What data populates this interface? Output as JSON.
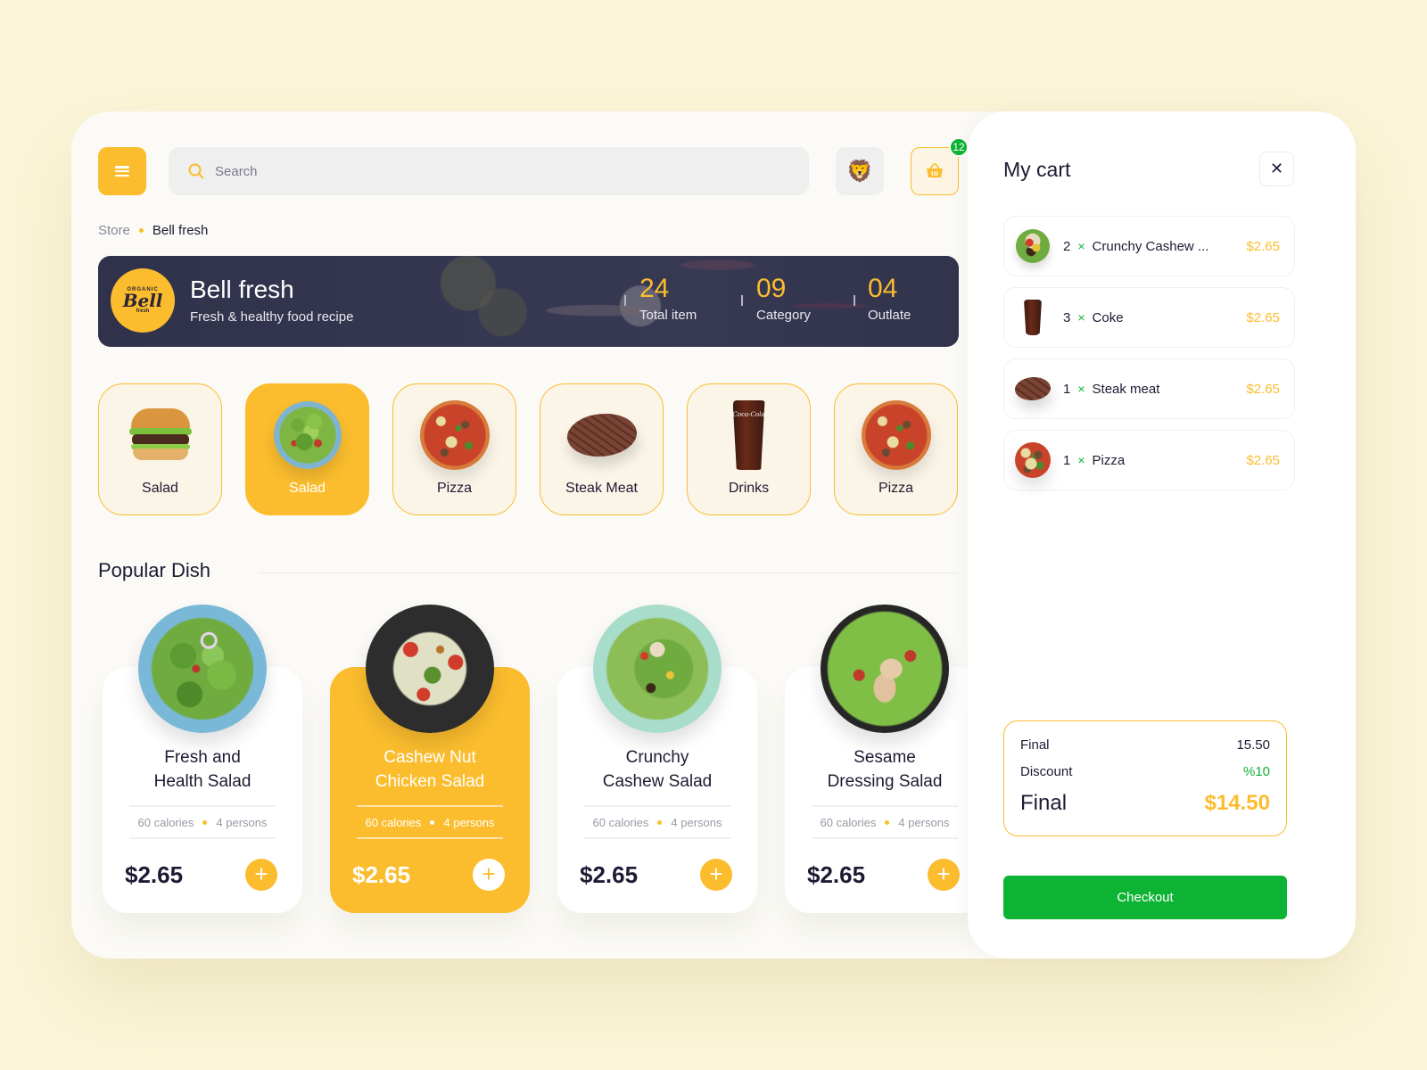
{
  "header": {
    "search_placeholder": "Search",
    "avatar_emoji": "🦁",
    "cart_badge_count": "12"
  },
  "breadcrumb": {
    "root": "Store",
    "current": "Bell fresh"
  },
  "store": {
    "logo_top": "ORGANIC",
    "logo_main": "Bell",
    "logo_bottom": "fresh",
    "name": "Bell fresh",
    "tagline": "Fresh & healthy food recipe",
    "stats": [
      {
        "value": "24",
        "label": "Total item"
      },
      {
        "value": "09",
        "label": "Category"
      },
      {
        "value": "04",
        "label": "Outlate"
      }
    ]
  },
  "categories": [
    {
      "label": "Salad",
      "icon": "burger",
      "active": false
    },
    {
      "label": "Salad",
      "icon": "salad",
      "active": true
    },
    {
      "label": "Pizza",
      "icon": "pizza",
      "active": false
    },
    {
      "label": "Steak Meat",
      "icon": "steak",
      "active": false
    },
    {
      "label": "Drinks",
      "icon": "cola",
      "active": false
    },
    {
      "label": "Pizza",
      "icon": "pizza",
      "active": false
    }
  ],
  "popular": {
    "title": "Popular Dish",
    "dishes": [
      {
        "name_line1": "Fresh and",
        "name_line2": "Health Salad",
        "calories": "60 calories",
        "persons": "4 persons",
        "price": "$2.65",
        "active": false
      },
      {
        "name_line1": "Cashew Nut",
        "name_line2": "Chicken Salad",
        "calories": "60 calories",
        "persons": "4 persons",
        "price": "$2.65",
        "active": true
      },
      {
        "name_line1": "Crunchy",
        "name_line2": "Cashew Salad",
        "calories": "60 calories",
        "persons": "4 persons",
        "price": "$2.65",
        "active": false
      },
      {
        "name_line1": "Sesame",
        "name_line2": "Dressing Salad",
        "calories": "60 calories",
        "persons": "4 persons",
        "price": "$2.65",
        "active": false
      }
    ],
    "add_symbol": "+"
  },
  "cart": {
    "title": "My cart",
    "close_symbol": "✕",
    "items": [
      {
        "qty": "2",
        "times": "×",
        "name": "Crunchy Cashew ...",
        "price": "$2.65",
        "icon": "salad"
      },
      {
        "qty": "3",
        "times": "×",
        "name": "Coke",
        "price": "$2.65",
        "icon": "cola"
      },
      {
        "qty": "1",
        "times": "×",
        "name": "Steak meat",
        "price": "$2.65",
        "icon": "steak"
      },
      {
        "qty": "1",
        "times": "×",
        "name": "Pizza",
        "price": "$2.65",
        "icon": "pizza"
      }
    ],
    "summary": {
      "subtotal_label": "Final",
      "subtotal_value": "15.50",
      "discount_label": "Discount",
      "discount_value": "%10",
      "total_label": "Final",
      "total_value": "$14.50"
    },
    "checkout_label": "Checkout"
  },
  "colors": {
    "accent": "#fbbd2e",
    "success": "#0db434",
    "background": "#fbf5d9",
    "text": "#1d1b33"
  }
}
